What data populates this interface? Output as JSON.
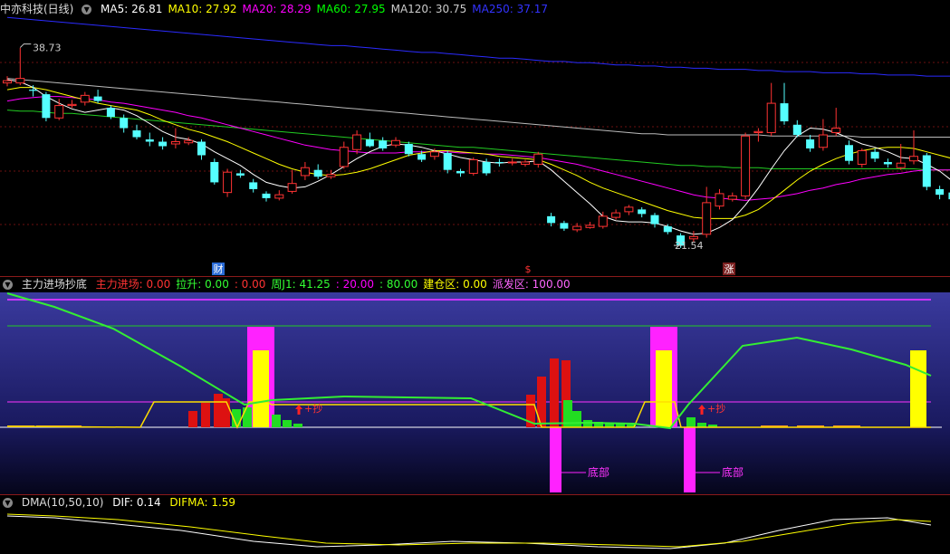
{
  "main": {
    "title": "中亦科技(日线)",
    "ma": [
      {
        "label": "MA5: 26.81",
        "color": "#ffffff"
      },
      {
        "label": "MA10: 27.92",
        "color": "#ffff00"
      },
      {
        "label": "MA20: 28.29",
        "color": "#ff00ff"
      },
      {
        "label": "MA60: 27.95",
        "color": "#00ff00"
      },
      {
        "label": "MA120: 30.75",
        "color": "#cccccc"
      },
      {
        "label": "MA250: 37.17",
        "color": "#3333ff"
      }
    ],
    "high_label": "38.73",
    "low_label": "21.54",
    "markers": [
      "财",
      "$",
      "涨"
    ]
  },
  "ind": {
    "title": "主力进场抄底",
    "items": [
      {
        "label": "主力进场: 0.00",
        "color": "#ff3333"
      },
      {
        "label": "拉升: 0.00",
        "color": "#33ff33"
      },
      {
        "label": ": 0.00",
        "color": "#ff3333"
      },
      {
        "label": "周J1: 41.25",
        "color": "#33ff33"
      },
      {
        "label": ": 20.00",
        "color": "#ff00ff"
      },
      {
        "label": ": 80.00",
        "color": "#33ff33"
      },
      {
        "label": "建仓区: 0.00",
        "color": "#ffff00"
      },
      {
        "label": "派发区: 100.00",
        "color": "#ff66ff"
      }
    ],
    "chao_label": "+抄",
    "bottom_label": "底部"
  },
  "dma": {
    "title": "DMA(10,50,10)",
    "dif": "DIF: 0.14",
    "difma": "DIFMA: 1.59"
  },
  "chart_data": {
    "type": "candlestick",
    "high": 38.73,
    "low": 21.54,
    "ylim": [
      18.5,
      41.5
    ],
    "candles": [
      [
        35.6,
        35.8,
        36.2,
        35.3
      ],
      [
        35.6,
        36.0,
        38.7,
        35.4
      ],
      [
        35.0,
        34.9,
        35.4,
        34.4
      ],
      [
        34.6,
        32.5,
        34.8,
        32.2
      ],
      [
        32.5,
        33.6,
        34.2,
        32.3
      ],
      [
        33.6,
        33.7,
        34.1,
        33.4
      ],
      [
        33.9,
        34.5,
        34.8,
        33.6
      ],
      [
        34.4,
        34.0,
        35.0,
        33.8
      ],
      [
        33.4,
        32.6,
        33.6,
        32.4
      ],
      [
        32.5,
        31.6,
        32.8,
        31.2
      ],
      [
        31.4,
        30.8,
        31.9,
        30.6
      ],
      [
        30.6,
        30.4,
        31.2,
        30.0
      ],
      [
        30.4,
        30.0,
        30.8,
        29.7
      ],
      [
        30.2,
        30.4,
        31.6,
        29.8
      ],
      [
        30.3,
        30.5,
        30.8,
        30.1
      ],
      [
        30.4,
        29.2,
        30.6,
        28.8
      ],
      [
        28.6,
        26.8,
        28.9,
        26.6
      ],
      [
        25.9,
        27.7,
        28.0,
        25.5
      ],
      [
        27.6,
        27.4,
        27.9,
        27.2
      ],
      [
        26.8,
        26.2,
        27.1,
        25.9
      ],
      [
        25.8,
        25.4,
        26.0,
        25.1
      ],
      [
        25.4,
        25.7,
        26.1,
        25.2
      ],
      [
        26.0,
        26.7,
        27.9,
        25.8
      ],
      [
        27.4,
        28.1,
        28.6,
        27.0
      ],
      [
        27.9,
        27.3,
        28.4,
        27.1
      ],
      [
        27.3,
        27.5,
        27.9,
        27.1
      ],
      [
        28.2,
        29.9,
        30.4,
        28.0
      ],
      [
        29.7,
        31.0,
        31.4,
        29.3
      ],
      [
        30.6,
        30.0,
        31.2,
        29.9
      ],
      [
        30.5,
        29.8,
        30.8,
        29.6
      ],
      [
        30.1,
        30.5,
        30.8,
        29.9
      ],
      [
        30.2,
        29.3,
        30.4,
        29.1
      ],
      [
        29.3,
        28.8,
        29.6,
        28.6
      ],
      [
        29.1,
        29.5,
        29.8,
        28.8
      ],
      [
        29.4,
        27.9,
        29.6,
        27.6
      ],
      [
        27.8,
        27.6,
        28.0,
        27.3
      ],
      [
        27.6,
        28.8,
        29.0,
        27.4
      ],
      [
        28.6,
        27.6,
        28.9,
        27.4
      ],
      [
        28.6,
        28.5,
        28.9,
        28.2
      ],
      [
        28.6,
        28.6,
        28.9,
        28.3
      ],
      [
        28.4,
        28.6,
        28.8,
        28.2
      ],
      [
        28.4,
        29.3,
        29.5,
        28.1
      ],
      [
        23.8,
        23.2,
        24.1,
        22.9
      ],
      [
        23.2,
        22.7,
        23.4,
        22.5
      ],
      [
        22.6,
        22.9,
        23.2,
        22.4
      ],
      [
        22.8,
        23.0,
        23.3,
        22.7
      ],
      [
        22.9,
        23.8,
        24.2,
        22.7
      ],
      [
        23.7,
        24.1,
        24.4,
        23.5
      ],
      [
        24.2,
        24.6,
        24.8,
        23.9
      ],
      [
        24.4,
        24.0,
        24.6,
        23.7
      ],
      [
        23.9,
        23.1,
        24.1,
        22.8
      ],
      [
        22.9,
        22.4,
        23.1,
        22.2
      ],
      [
        22.1,
        21.2,
        22.3,
        21.0
      ],
      [
        21.8,
        22.0,
        22.5,
        21.5
      ],
      [
        22.2,
        25.0,
        26.4,
        21.9
      ],
      [
        24.7,
        25.8,
        26.2,
        24.4
      ],
      [
        25.3,
        25.6,
        25.9,
        25.1
      ],
      [
        25.6,
        30.9,
        31.2,
        25.3
      ],
      [
        31.2,
        31.3,
        31.6,
        30.4
      ],
      [
        31.2,
        33.8,
        35.6,
        30.9
      ],
      [
        33.8,
        32.2,
        35.6,
        31.9
      ],
      [
        31.9,
        31.0,
        32.3,
        30.8
      ],
      [
        30.6,
        29.8,
        31.0,
        29.5
      ],
      [
        29.9,
        31.0,
        32.4,
        29.6
      ],
      [
        31.2,
        31.6,
        33.4,
        30.9
      ],
      [
        30.1,
        28.7,
        30.5,
        28.4
      ],
      [
        28.4,
        29.6,
        29.8,
        28.1
      ],
      [
        29.5,
        28.9,
        29.8,
        28.6
      ],
      [
        28.6,
        28.4,
        28.9,
        28.1
      ],
      [
        28.1,
        28.5,
        30.2,
        27.9
      ],
      [
        28.7,
        29.1,
        31.4,
        28.4
      ],
      [
        29.2,
        26.4,
        29.4,
        26.1
      ],
      [
        26.2,
        25.7,
        26.5,
        25.3
      ],
      [
        25.9,
        25.3,
        26.2,
        25.0
      ]
    ],
    "ma5": [
      35.9,
      35.7,
      35.2,
      34.4,
      33.8,
      33.3,
      33.0,
      33.2,
      33.4,
      33.2,
      32.7,
      32.0,
      31.3,
      30.8,
      30.6,
      30.2,
      29.5,
      28.9,
      28.3,
      27.5,
      26.8,
      26.5,
      26.3,
      26.4,
      26.9,
      27.5,
      28.2,
      28.9,
      29.5,
      30.0,
      30.2,
      30.1,
      29.9,
      29.6,
      29.3,
      29.0,
      28.8,
      28.6,
      28.5,
      28.6,
      28.6,
      28.7,
      27.9,
      26.9,
      25.9,
      24.9,
      23.8,
      23.4,
      23.3,
      23.3,
      23.2,
      22.9,
      22.5,
      22.2,
      22.3,
      22.8,
      23.5,
      24.8,
      26.3,
      28.0,
      29.6,
      30.9,
      31.6,
      31.5,
      31.2,
      30.7,
      30.2,
      29.9,
      29.5,
      29.0,
      28.9,
      28.4,
      27.8,
      26.9
    ],
    "ma10": [
      35.0,
      35.2,
      35.2,
      35.0,
      34.7,
      34.4,
      34.1,
      33.8,
      33.6,
      33.4,
      33.2,
      32.8,
      32.3,
      31.9,
      31.5,
      31.2,
      30.8,
      30.4,
      29.9,
      29.4,
      28.9,
      28.4,
      28.0,
      27.7,
      27.5,
      27.4,
      27.5,
      27.7,
      28.0,
      28.4,
      28.8,
      29.2,
      29.4,
      29.6,
      29.6,
      29.5,
      29.4,
      29.3,
      29.1,
      29.0,
      28.9,
      28.8,
      28.4,
      27.9,
      27.4,
      26.8,
      26.3,
      25.9,
      25.5,
      25.1,
      24.7,
      24.3,
      24.0,
      23.7,
      23.6,
      23.6,
      23.6,
      23.9,
      24.4,
      25.2,
      26.1,
      27.0,
      27.8,
      28.4,
      28.9,
      29.3,
      29.6,
      29.8,
      29.9,
      29.9,
      29.8,
      29.5,
      29.2,
      28.9
    ],
    "ma20": [
      34.0,
      34.2,
      34.3,
      34.4,
      34.4,
      34.3,
      34.2,
      34.1,
      33.9,
      33.8,
      33.6,
      33.4,
      33.2,
      33.0,
      32.7,
      32.5,
      32.2,
      31.9,
      31.6,
      31.3,
      31.0,
      30.7,
      30.4,
      30.1,
      29.9,
      29.7,
      29.6,
      29.5,
      29.4,
      29.4,
      29.4,
      29.5,
      29.5,
      29.5,
      29.5,
      29.4,
      29.4,
      29.3,
      29.3,
      29.2,
      29.1,
      29.0,
      28.8,
      28.6,
      28.4,
      28.1,
      27.8,
      27.5,
      27.2,
      26.9,
      26.6,
      26.3,
      26.0,
      25.7,
      25.5,
      25.4,
      25.3,
      25.2,
      25.3,
      25.4,
      25.6,
      25.8,
      26.1,
      26.3,
      26.6,
      26.8,
      27.1,
      27.3,
      27.5,
      27.6,
      27.8,
      27.9,
      27.9,
      27.9
    ],
    "ma60": [
      33.2,
      33.1,
      33.1,
      33.0,
      32.9,
      32.9,
      32.8,
      32.7,
      32.6,
      32.5,
      32.4,
      32.3,
      32.2,
      32.1,
      32.0,
      31.9,
      31.8,
      31.7,
      31.6,
      31.5,
      31.4,
      31.3,
      31.2,
      31.1,
      31.0,
      30.9,
      30.8,
      30.7,
      30.6,
      30.5,
      30.4,
      30.3,
      30.2,
      30.1,
      30.0,
      29.9,
      29.9,
      29.8,
      29.7,
      29.6,
      29.5,
      29.4,
      29.3,
      29.2,
      29.1,
      29.0,
      28.9,
      28.8,
      28.7,
      28.6,
      28.5,
      28.4,
      28.3,
      28.3,
      28.2,
      28.2,
      28.1,
      28.1,
      28.1,
      28.0,
      28.0,
      28.0,
      28.0,
      28.0,
      28.0,
      28.0,
      28.0,
      28.0,
      28.0,
      28.0,
      28.0,
      27.9,
      27.9,
      27.9
    ],
    "ma120": [
      36.0,
      35.9,
      35.8,
      35.7,
      35.6,
      35.5,
      35.4,
      35.3,
      35.2,
      35.1,
      35.0,
      34.9,
      34.8,
      34.7,
      34.6,
      34.5,
      34.4,
      34.3,
      34.2,
      34.1,
      34.0,
      33.9,
      33.8,
      33.7,
      33.6,
      33.5,
      33.4,
      33.3,
      33.2,
      33.1,
      33.0,
      32.9,
      32.8,
      32.7,
      32.6,
      32.5,
      32.4,
      32.3,
      32.2,
      32.1,
      32.0,
      31.9,
      31.8,
      31.7,
      31.6,
      31.5,
      31.4,
      31.3,
      31.2,
      31.1,
      31.1,
      31.0,
      31.0,
      31.0,
      31.0,
      31.0,
      31.0,
      31.0,
      31.0,
      30.9,
      30.9,
      30.9,
      30.9,
      30.9,
      30.9,
      30.9,
      30.8,
      30.8,
      30.8,
      30.8,
      30.8,
      30.8,
      30.8,
      30.8
    ],
    "ma250": [
      41.4,
      41.3,
      41.2,
      41.1,
      41.0,
      40.9,
      40.8,
      40.7,
      40.6,
      40.5,
      40.4,
      40.3,
      40.2,
      40.1,
      40.0,
      39.9,
      39.8,
      39.7,
      39.6,
      39.5,
      39.4,
      39.3,
      39.2,
      39.1,
      39.0,
      38.9,
      38.9,
      38.8,
      38.7,
      38.6,
      38.5,
      38.4,
      38.3,
      38.3,
      38.2,
      38.1,
      38.0,
      37.9,
      37.8,
      37.8,
      37.7,
      37.6,
      37.5,
      37.5,
      37.4,
      37.4,
      37.3,
      37.2,
      37.2,
      37.1,
      37.1,
      37.0,
      37.0,
      36.9,
      36.9,
      36.8,
      36.8,
      36.8,
      36.7,
      36.7,
      36.6,
      36.6,
      36.6,
      36.5,
      36.5,
      36.5,
      36.4,
      36.4,
      36.3,
      36.3,
      36.3,
      36.2,
      36.2,
      36.2
    ]
  }
}
